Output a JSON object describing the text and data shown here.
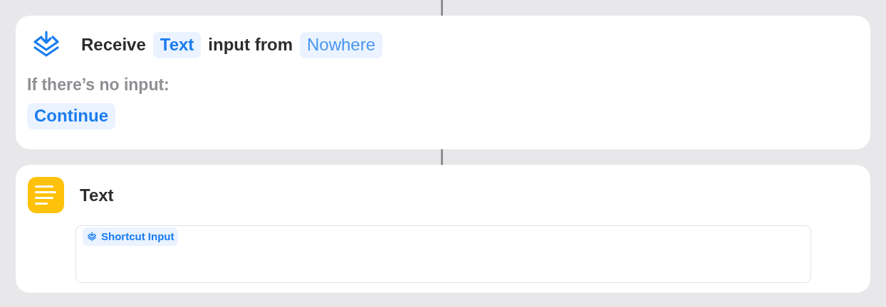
{
  "actions": [
    {
      "kind": "receive",
      "title_parts": [
        {
          "kind": "text",
          "text": "Receive"
        },
        {
          "kind": "param",
          "text": "Text",
          "set": true
        },
        {
          "kind": "text",
          "text": "input from"
        },
        {
          "kind": "param",
          "text": "Nowhere",
          "set": false
        }
      ],
      "fallback_label": "If there’s no input:",
      "fallback_value": "Continue"
    },
    {
      "kind": "text",
      "title": "Text",
      "content_tokens": [
        {
          "text": "Shortcut Input"
        }
      ]
    }
  ]
}
